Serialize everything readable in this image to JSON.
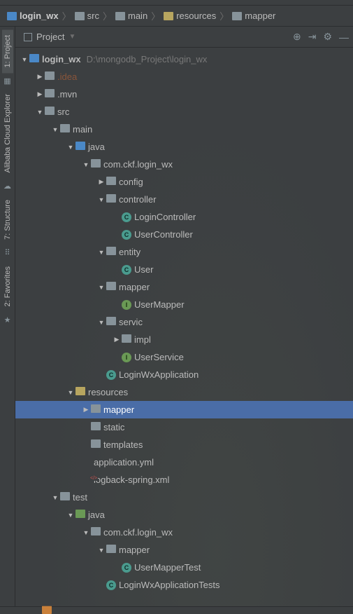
{
  "breadcrumb": [
    {
      "label": "login_wx",
      "icon": "root",
      "bold": true
    },
    {
      "label": "src",
      "icon": "folder"
    },
    {
      "label": "main",
      "icon": "folder"
    },
    {
      "label": "resources",
      "icon": "res"
    },
    {
      "label": "mapper",
      "icon": "folder"
    }
  ],
  "panel": {
    "title": "Project"
  },
  "rail": [
    {
      "label": "1: Project",
      "active": true,
      "icon": "folder"
    },
    {
      "label": "Alibaba Cloud Explorer",
      "icon": "cloud"
    },
    {
      "label": "7: Structure",
      "icon": "struct"
    },
    {
      "label": "2: Favorites",
      "icon": "star"
    }
  ],
  "tree": [
    {
      "d": 0,
      "a": "down",
      "i": "root",
      "t": "login_wx",
      "bold": true,
      "hint": "D:\\mongodb_Project\\login_wx"
    },
    {
      "d": 1,
      "a": "right",
      "i": "folder",
      "t": ".idea",
      "cls": "idea"
    },
    {
      "d": 1,
      "a": "right",
      "i": "folder",
      "t": ".mvn"
    },
    {
      "d": 1,
      "a": "down",
      "i": "folder",
      "t": "src"
    },
    {
      "d": 2,
      "a": "down",
      "i": "folder",
      "t": "main"
    },
    {
      "d": 3,
      "a": "down",
      "i": "srcf",
      "t": "java"
    },
    {
      "d": 4,
      "a": "down",
      "i": "folder",
      "t": "com.ckf.login_wx"
    },
    {
      "d": 5,
      "a": "right",
      "i": "folder",
      "t": "config"
    },
    {
      "d": 5,
      "a": "down",
      "i": "folder",
      "t": "controller"
    },
    {
      "d": 6,
      "a": "",
      "i": "class",
      "t": "LoginController"
    },
    {
      "d": 6,
      "a": "",
      "i": "class",
      "t": "UserController"
    },
    {
      "d": 5,
      "a": "down",
      "i": "folder",
      "t": "entity"
    },
    {
      "d": 6,
      "a": "",
      "i": "class",
      "t": "User"
    },
    {
      "d": 5,
      "a": "down",
      "i": "folder",
      "t": "mapper"
    },
    {
      "d": 6,
      "a": "",
      "i": "iface",
      "t": "UserMapper"
    },
    {
      "d": 5,
      "a": "down",
      "i": "folder",
      "t": "servic"
    },
    {
      "d": 6,
      "a": "right",
      "i": "folder",
      "t": "impl"
    },
    {
      "d": 6,
      "a": "",
      "i": "iface",
      "t": "UserService"
    },
    {
      "d": 5,
      "a": "",
      "i": "spring",
      "t": "LoginWxApplication"
    },
    {
      "d": 3,
      "a": "down",
      "i": "res",
      "t": "resources"
    },
    {
      "d": 4,
      "a": "right",
      "i": "folder",
      "t": "mapper",
      "sel": true
    },
    {
      "d": 4,
      "a": "",
      "i": "folder",
      "t": "static"
    },
    {
      "d": 4,
      "a": "",
      "i": "folder",
      "t": "templates"
    },
    {
      "d": 4,
      "a": "",
      "i": "yml",
      "t": "application.yml"
    },
    {
      "d": 4,
      "a": "",
      "i": "xml",
      "t": "logback-spring.xml"
    },
    {
      "d": 2,
      "a": "down",
      "i": "folder",
      "t": "test"
    },
    {
      "d": 3,
      "a": "down",
      "i": "test",
      "t": "java"
    },
    {
      "d": 4,
      "a": "down",
      "i": "folder",
      "t": "com.ckf.login_wx"
    },
    {
      "d": 5,
      "a": "down",
      "i": "folder",
      "t": "mapper"
    },
    {
      "d": 6,
      "a": "",
      "i": "class",
      "t": "UserMapperTest"
    },
    {
      "d": 5,
      "a": "",
      "i": "spring",
      "t": "LoginWxApplicationTests"
    }
  ]
}
